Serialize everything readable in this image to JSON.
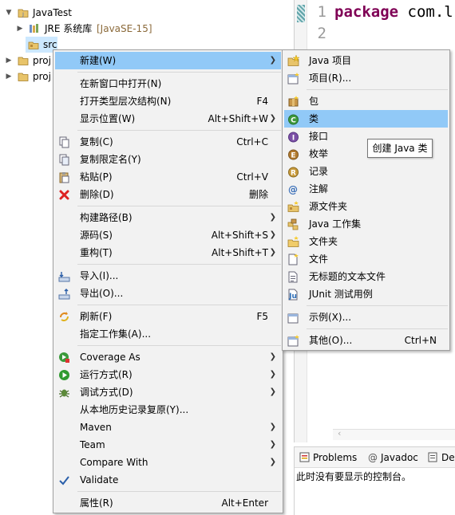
{
  "tree": {
    "project_name": "JavaTest",
    "jre_label": "JRE 系统库",
    "jre_decoration": "[JavaSE-15]",
    "src_label": "src",
    "other_projects": [
      "proj",
      "proj"
    ]
  },
  "editor": {
    "lines": [
      {
        "num": "1",
        "keyword": "package",
        "rest": " com.l"
      },
      {
        "num": "2",
        "keyword": "",
        "rest": ""
      }
    ]
  },
  "console": {
    "tabs": [
      "Problems",
      "Javadoc",
      "De"
    ],
    "message": "此时没有要显示的控制台。"
  },
  "context_menu": {
    "items": [
      {
        "label": "新建(W)",
        "shortcut": "",
        "submenu": true
      },
      {
        "label": "在新窗口中打开(N)",
        "shortcut": "",
        "submenu": false
      },
      {
        "label": "打开类型层次结构(N)",
        "shortcut": "F4",
        "submenu": false
      },
      {
        "label": "显示位置(W)",
        "shortcut": "Alt+Shift+W",
        "submenu": true
      },
      {
        "label": "复制(C)",
        "shortcut": "Ctrl+C",
        "submenu": false
      },
      {
        "label": "复制限定名(Y)",
        "shortcut": "",
        "submenu": false
      },
      {
        "label": "粘贴(P)",
        "shortcut": "Ctrl+V",
        "submenu": false
      },
      {
        "label": "删除(D)",
        "shortcut": "删除",
        "submenu": false
      },
      {
        "label": "构建路径(B)",
        "shortcut": "",
        "submenu": true
      },
      {
        "label": "源码(S)",
        "shortcut": "Alt+Shift+S",
        "submenu": true
      },
      {
        "label": "重构(T)",
        "shortcut": "Alt+Shift+T",
        "submenu": true
      },
      {
        "label": "导入(I)...",
        "shortcut": "",
        "submenu": false
      },
      {
        "label": "导出(O)...",
        "shortcut": "",
        "submenu": false
      },
      {
        "label": "刷新(F)",
        "shortcut": "F5",
        "submenu": false
      },
      {
        "label": "指定工作集(A)...",
        "shortcut": "",
        "submenu": false
      },
      {
        "label": "Coverage As",
        "shortcut": "",
        "submenu": true
      },
      {
        "label": "运行方式(R)",
        "shortcut": "",
        "submenu": true
      },
      {
        "label": "调试方式(D)",
        "shortcut": "",
        "submenu": true
      },
      {
        "label": "从本地历史记录复原(Y)...",
        "shortcut": "",
        "submenu": false
      },
      {
        "label": "Maven",
        "shortcut": "",
        "submenu": true
      },
      {
        "label": "Team",
        "shortcut": "",
        "submenu": true
      },
      {
        "label": "Compare With",
        "shortcut": "",
        "submenu": true
      },
      {
        "label": "Validate",
        "shortcut": "",
        "submenu": false
      },
      {
        "label": "属性(R)",
        "shortcut": "Alt+Enter",
        "submenu": false
      }
    ]
  },
  "submenu": {
    "items": [
      {
        "label": "Java 项目",
        "shortcut": ""
      },
      {
        "label": "项目(R)...",
        "shortcut": ""
      },
      {
        "label": "包",
        "shortcut": ""
      },
      {
        "label": "类",
        "shortcut": ""
      },
      {
        "label": "接口",
        "shortcut": ""
      },
      {
        "label": "枚举",
        "shortcut": ""
      },
      {
        "label": "记录",
        "shortcut": ""
      },
      {
        "label": "注解",
        "shortcut": ""
      },
      {
        "label": "源文件夹",
        "shortcut": ""
      },
      {
        "label": "Java 工作集",
        "shortcut": ""
      },
      {
        "label": "文件夹",
        "shortcut": ""
      },
      {
        "label": "文件",
        "shortcut": ""
      },
      {
        "label": "无标题的文本文件",
        "shortcut": ""
      },
      {
        "label": "JUnit 测试用例",
        "shortcut": ""
      },
      {
        "label": "示例(X)...",
        "shortcut": ""
      },
      {
        "label": "其他(O)...",
        "shortcut": "Ctrl+N"
      }
    ]
  },
  "tooltip": {
    "text": "创建 Java 类"
  },
  "colors": {
    "highlight": "#91c9f7",
    "menu_bg": "#f2f2f2",
    "keyword": "#7f0055",
    "decoration": "#8b6a3a"
  }
}
